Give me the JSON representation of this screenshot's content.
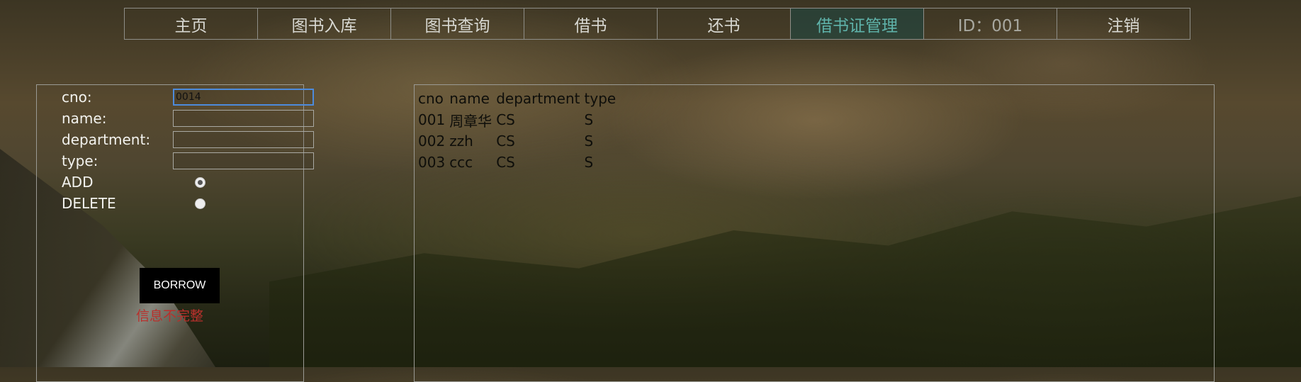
{
  "nav": {
    "items": [
      {
        "label": "主页"
      },
      {
        "label": "图书入库"
      },
      {
        "label": "图书查询"
      },
      {
        "label": "借书"
      },
      {
        "label": "还书"
      },
      {
        "label": "借书证管理"
      },
      {
        "label": "ID：001"
      },
      {
        "label": "注销"
      }
    ],
    "active_index": 5,
    "active_color": "#5fb3aa"
  },
  "form": {
    "cno_label": "cno:",
    "cno_value": "0014",
    "name_label": "name:",
    "name_value": "",
    "department_label": "department:",
    "department_value": "",
    "type_label": "type:",
    "type_value": "",
    "add_label": "ADD",
    "delete_label": "DELETE",
    "selected_action": "ADD",
    "submit_label": "BORROW",
    "error_message": "信息不完整",
    "error_color": "#b9302c"
  },
  "table": {
    "headers": [
      "cno",
      "name",
      "department",
      "type"
    ],
    "rows": [
      [
        "001",
        "周章华",
        "CS",
        "S"
      ],
      [
        "002",
        "zzh",
        "CS",
        "S"
      ],
      [
        "003",
        "ccc",
        "CS",
        "S"
      ]
    ]
  }
}
